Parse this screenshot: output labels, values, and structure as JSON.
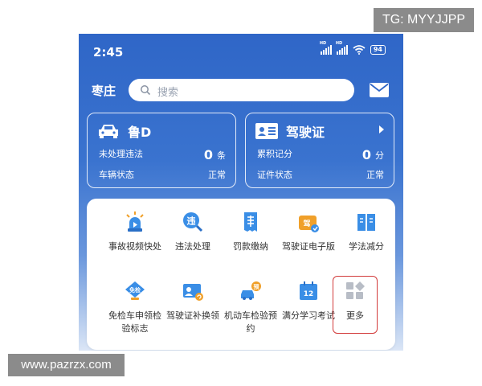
{
  "watermark_tg": "TG: MYYJJPP",
  "watermark_site": "www.pazrzx.com",
  "status": {
    "time": "2:45",
    "battery": "94"
  },
  "header": {
    "city": "枣庄",
    "search_placeholder": "搜索"
  },
  "vehicle_card": {
    "plate": "鲁D",
    "row1_label": "未处理违法",
    "row1_value": "0",
    "row1_unit": "条",
    "row2_label": "车辆状态",
    "row2_value": "正常"
  },
  "license_card": {
    "title": "驾驶证",
    "row1_label": "累积记分",
    "row1_value": "0",
    "row1_unit": "分",
    "row2_label": "证件状态",
    "row2_value": "正常"
  },
  "services": [
    {
      "label": "事故视频快处",
      "icon": "siren-icon"
    },
    {
      "label": "违法处理",
      "icon": "violation-search-icon",
      "badge": "违"
    },
    {
      "label": "罚款缴纳",
      "icon": "fine-receipt-icon"
    },
    {
      "label": "驾驶证电子版",
      "icon": "e-license-icon",
      "badge": "驾"
    },
    {
      "label": "学法减分",
      "icon": "book-icon"
    },
    {
      "label": "免检车申领检验标志",
      "icon": "exempt-badge-icon",
      "badge": "免检"
    },
    {
      "label": "驾驶证补换领",
      "icon": "license-renew-icon"
    },
    {
      "label": "机动车检验预约",
      "icon": "car-appointment-icon",
      "badge": "预"
    },
    {
      "label": "满分学习考试",
      "icon": "calendar-exam-icon",
      "badge": "12"
    },
    {
      "label": "更多",
      "icon": "more-grid-icon"
    }
  ],
  "colors": {
    "primary": "#2f66c7",
    "highlight": "#d23b3b"
  }
}
